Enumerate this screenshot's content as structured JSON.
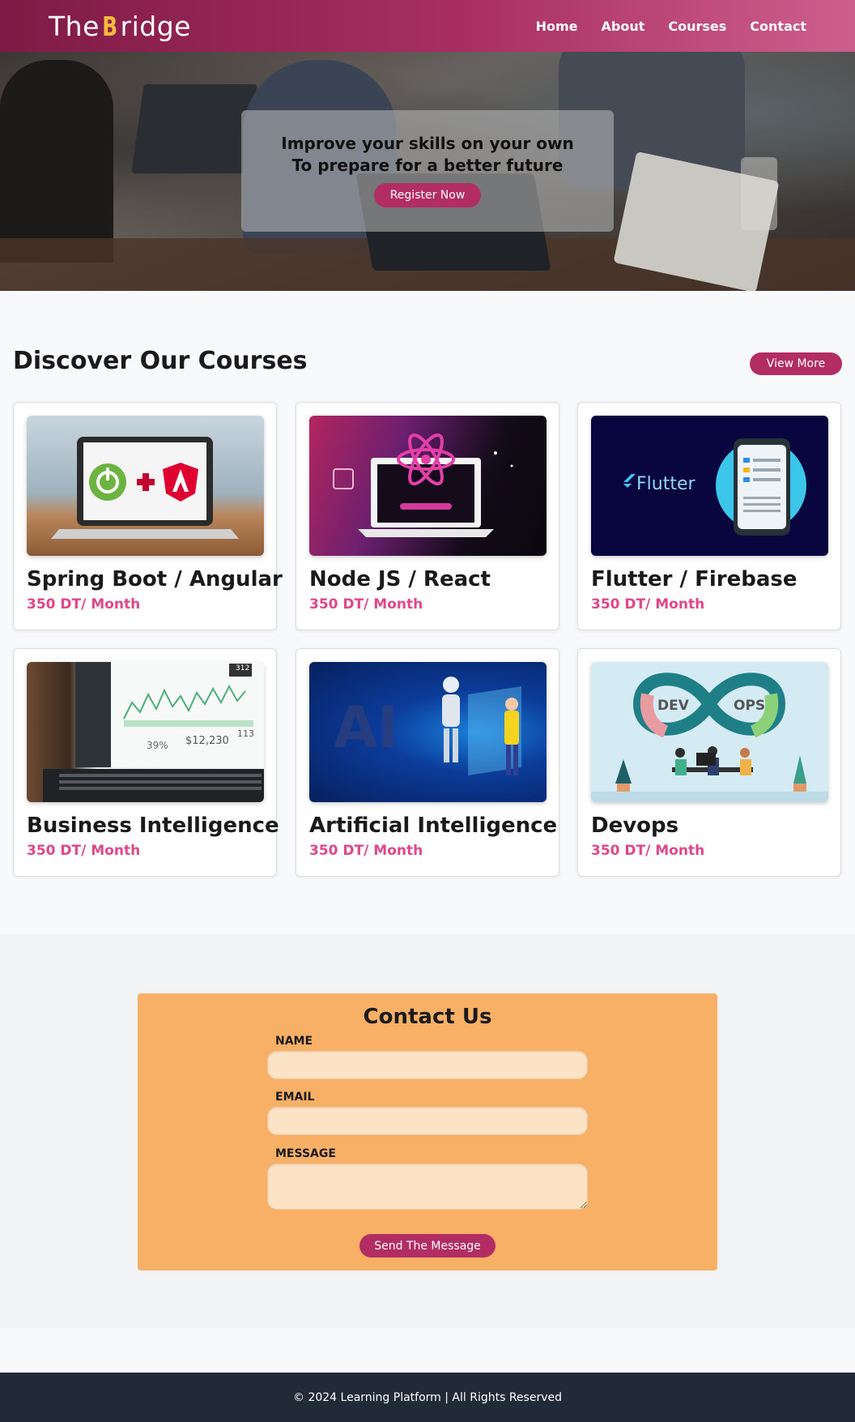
{
  "header": {
    "logo_prefix": "The ",
    "logo_b": "B",
    "logo_suffix": "ridge",
    "nav": [
      "Home",
      "About",
      "Courses",
      "Contact"
    ]
  },
  "hero": {
    "line1": "Improve your skills on your own",
    "line2": "To prepare for a better future",
    "button": "Register Now"
  },
  "courses": {
    "title": "Discover Our Courses",
    "view_more": "View More",
    "items": [
      {
        "title": "Spring Boot / Angular",
        "price": "350 DT/ Month"
      },
      {
        "title": "Node JS / React",
        "price": "350 DT/ Month"
      },
      {
        "title": "Flutter / Firebase",
        "price": "350 DT/ Month"
      },
      {
        "title": "Business Intelligence",
        "price": "350 DT/ Month"
      },
      {
        "title": "Artificial Intelligence",
        "price": "350 DT/ Month"
      },
      {
        "title": "Devops",
        "price": "350 DT/ Month"
      }
    ],
    "image_text": {
      "flutter": "Flutter",
      "bi_pct": "39%",
      "bi_amount": "$12,230",
      "bi_count": "113",
      "bi_badge": "312",
      "ai": "AI",
      "dev": "DEV",
      "ops": "OPS"
    }
  },
  "contact": {
    "title": "Contact Us",
    "name_label": "NAME",
    "email_label": "EMAIL",
    "message_label": "MESSAGE",
    "send_button": "Send The Message"
  },
  "footer": {
    "text": "© 2024 Learning Platform | All Rights Reserved"
  },
  "colors": {
    "brand": "#b22d64",
    "price": "#e0478a",
    "contact_bg": "#f8b066",
    "footer_bg": "#212a37"
  }
}
